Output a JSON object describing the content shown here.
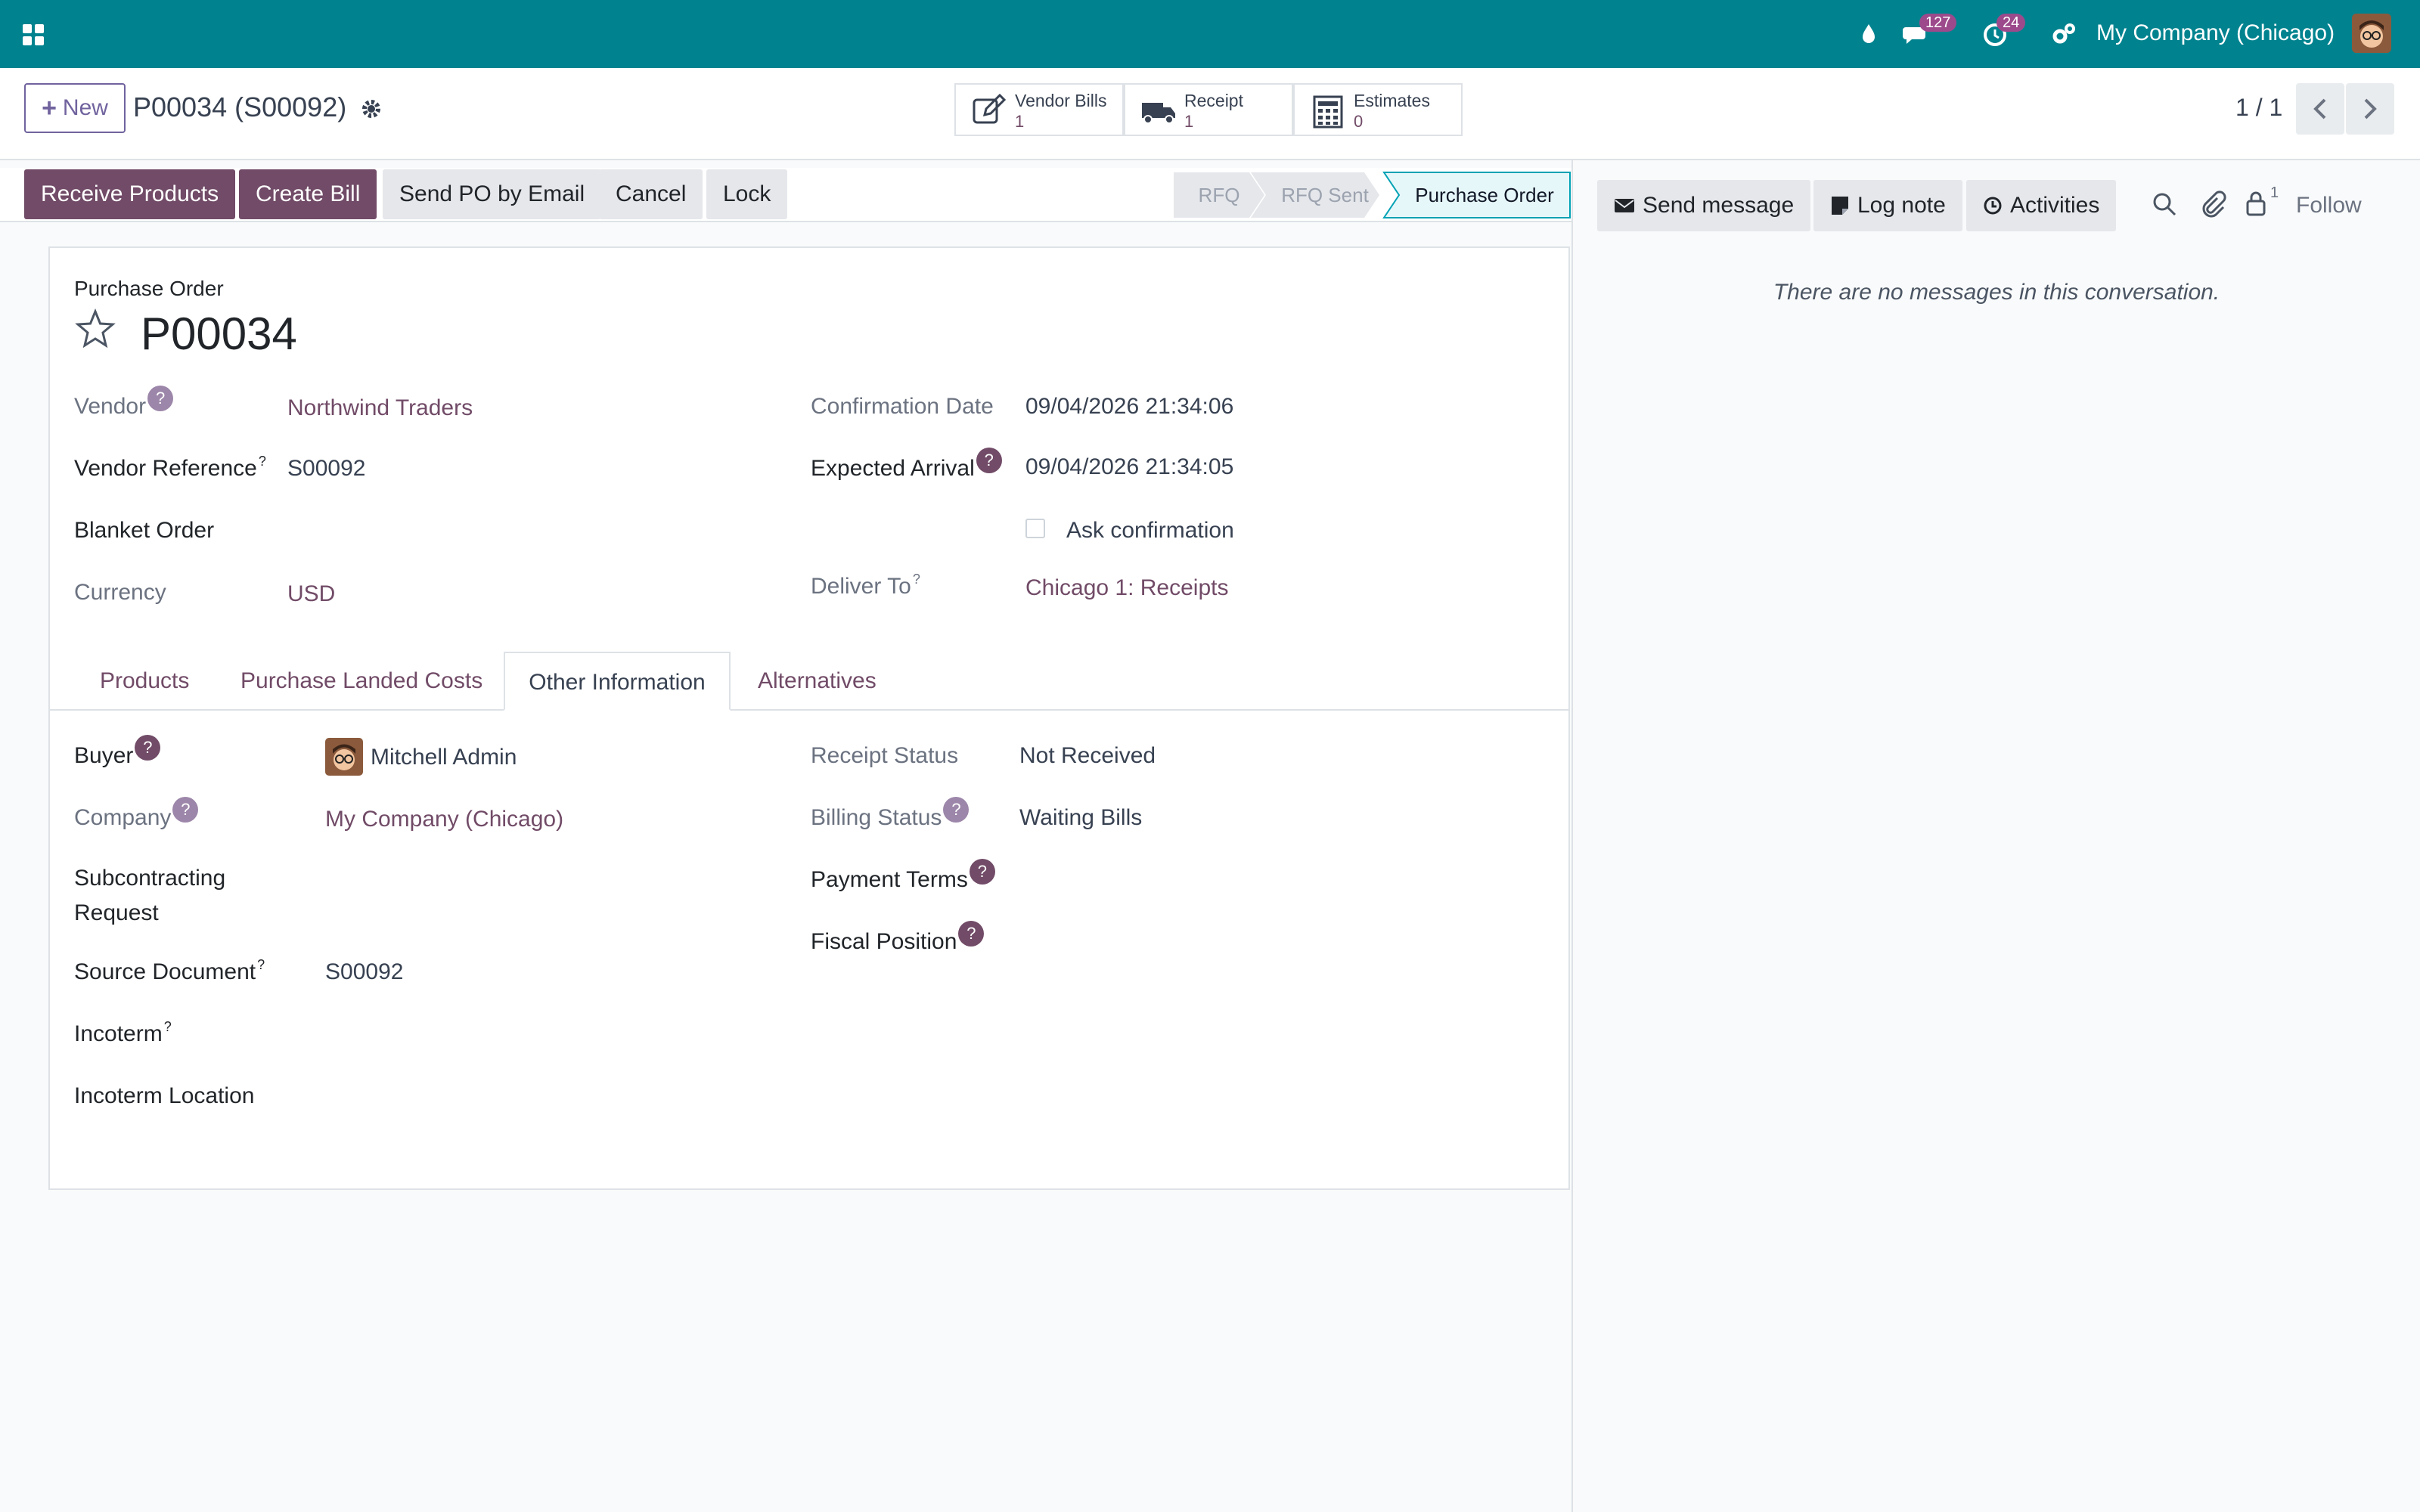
{
  "navbar": {
    "badge_messages": "127",
    "badge_activities": "24",
    "company": "My Company (Chicago)",
    "accent": "#00838f"
  },
  "control": {
    "new_label": "New",
    "breadcrumb": "P00034 (S00092)",
    "smart_buttons": [
      {
        "label": "Vendor Bills",
        "count": "1",
        "icon": "edit-icon"
      },
      {
        "label": "Receipt",
        "count": "1",
        "icon": "truck-icon"
      },
      {
        "label": "Estimates",
        "count": "0",
        "icon": "calculator-icon"
      }
    ],
    "pager": "1 / 1"
  },
  "statusbar": {
    "buttons": [
      "Receive Products",
      "Create Bill",
      "Send PO by Email",
      "Cancel",
      "Lock"
    ],
    "stages": [
      "RFQ",
      "RFQ Sent",
      "Purchase Order"
    ],
    "active_stage": "Purchase Order"
  },
  "form": {
    "doc_type": "Purchase Order",
    "name": "P00034",
    "left": {
      "vendor_label": "Vendor",
      "vendor": "Northwind Traders",
      "vendor_ref_label": "Vendor Reference",
      "vendor_ref": "S00092",
      "blanket_label": "Blanket Order",
      "currency_label": "Currency",
      "currency": "USD"
    },
    "right": {
      "confirm_label": "Confirmation Date",
      "confirm": "09/04/2026 21:34:06",
      "expected_label": "Expected Arrival",
      "expected": "09/04/2026 21:34:05",
      "ask_confirmation": "Ask confirmation",
      "deliver_label": "Deliver To",
      "deliver": "Chicago 1: Receipts"
    },
    "tabs": [
      "Products",
      "Purchase Landed Costs",
      "Other Information",
      "Alternatives"
    ],
    "active_tab": "Other Information",
    "other": {
      "buyer_label": "Buyer",
      "buyer": "Mitchell Admin",
      "company_label": "Company",
      "company": "My Company (Chicago)",
      "subcontracting_label_1": "Subcontracting",
      "subcontracting_label_2": "Request",
      "source_label": "Source Document",
      "source": "S00092",
      "incoterm_label": "Incoterm",
      "incoterm_location_label": "Incoterm Location",
      "receipt_status_label": "Receipt Status",
      "receipt_status": "Not Received",
      "billing_status_label": "Billing Status",
      "billing_status": "Waiting Bills",
      "payment_terms_label": "Payment Terms",
      "fiscal_position_label": "Fiscal Position"
    }
  },
  "chatter": {
    "send_message": "Send message",
    "log_note": "Log note",
    "activities": "Activities",
    "followers_count": "1",
    "follow": "Follow",
    "empty": "There are no messages in this conversation."
  },
  "colors": {
    "brand": "#714b67",
    "stage_active_bg": "#e6f7f9",
    "stage_active_border": "#00a2b5"
  }
}
